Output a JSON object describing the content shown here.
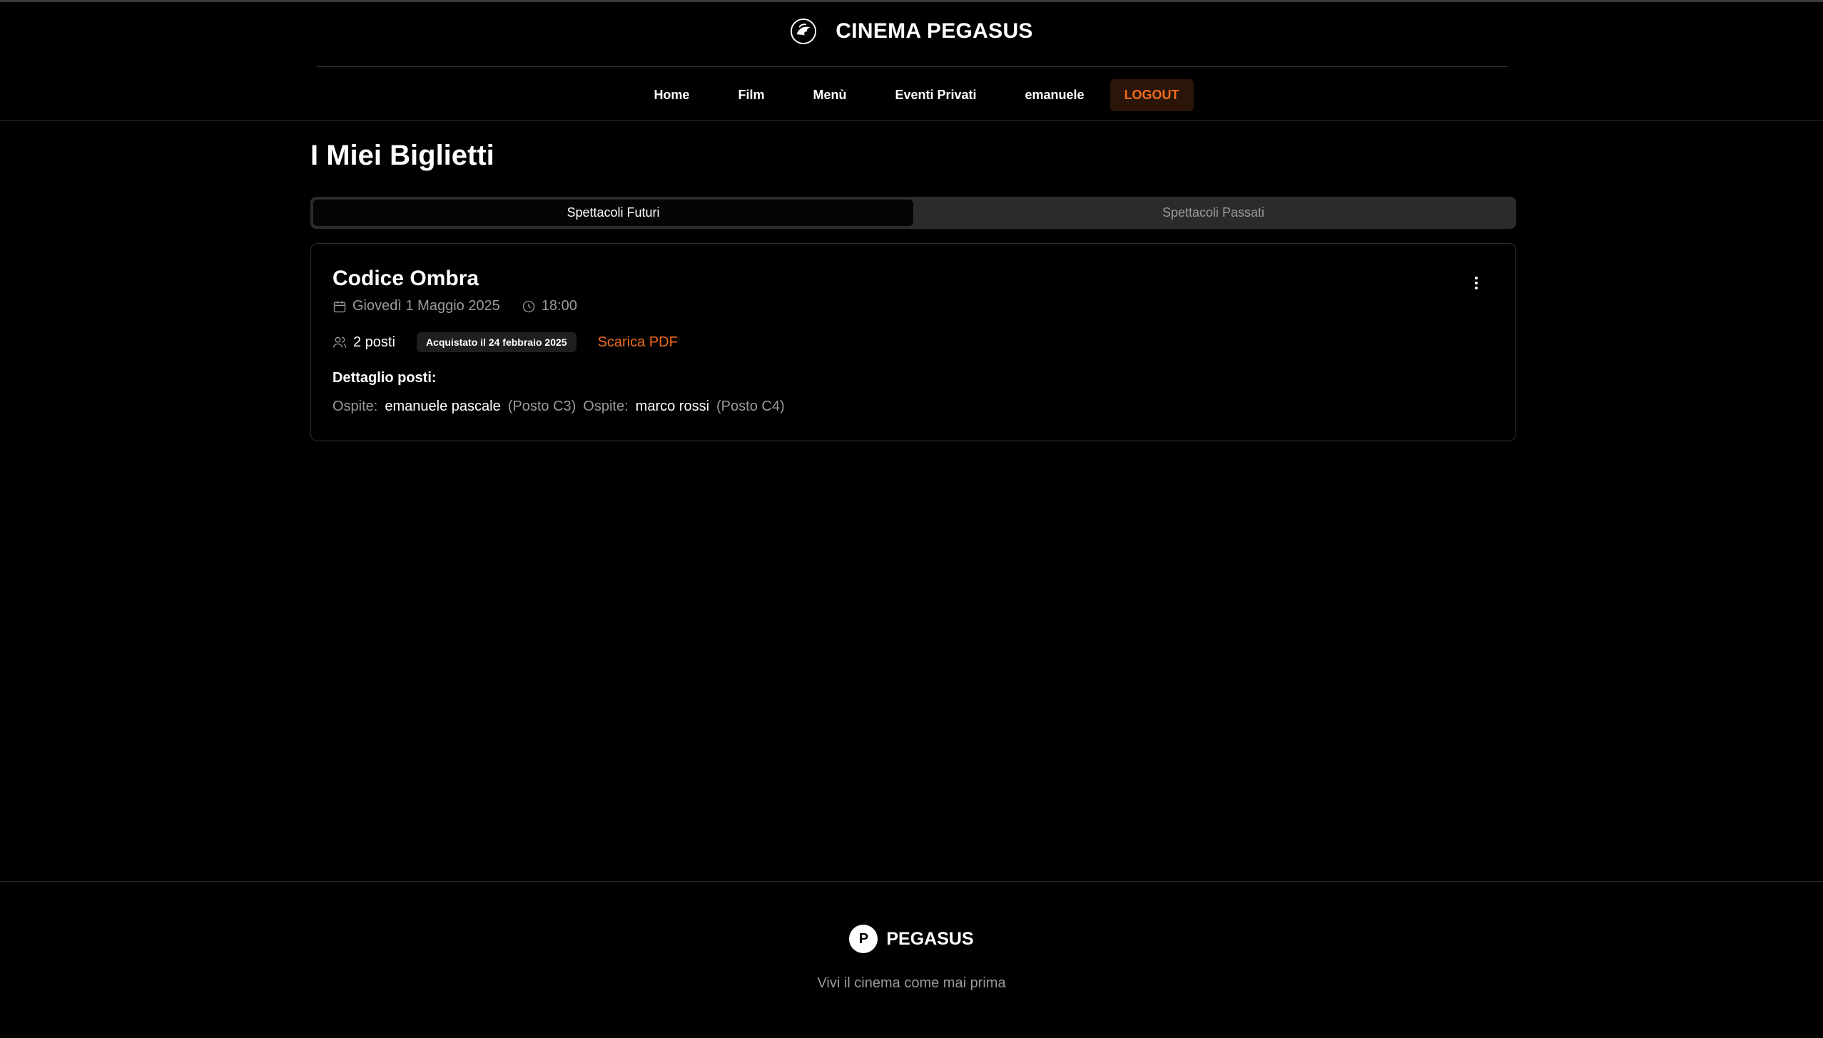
{
  "brand": {
    "title": "CINEMA PEGASUS"
  },
  "nav": {
    "items": [
      {
        "label": "Home"
      },
      {
        "label": "Film"
      },
      {
        "label": "Menù"
      },
      {
        "label": "Eventi Privati"
      },
      {
        "label": "emanuele"
      }
    ],
    "logout_label": "LOGOUT"
  },
  "page": {
    "title": "I Miei Biglietti"
  },
  "tabs": [
    {
      "label": "Spettacoli Futuri",
      "active": true
    },
    {
      "label": "Spettacoli Passati",
      "active": false
    }
  ],
  "ticket": {
    "title": "Codice Ombra",
    "date": "Giovedì 1 Maggio 2025",
    "time": "18:00",
    "seats": "2 posti",
    "purchase_badge": "Acquistato il 24 febbraio 2025",
    "pdf_label": "Scarica PDF",
    "detail_label": "Dettaglio posti:",
    "guests": [
      {
        "label": "Ospite:",
        "name": "emanuele pascale",
        "seat": "(Posto C3)"
      },
      {
        "label": "Ospite:",
        "name": "marco rossi",
        "seat": "(Posto C4)"
      }
    ]
  },
  "footer": {
    "logo_letter": "P",
    "name": "PEGASUS",
    "tagline": "Vivi il cinema come mai prima"
  },
  "colors": {
    "accent": "#f26b1d",
    "background": "#000000",
    "muted": "#9a9a9a"
  },
  "icons": [
    "pegasus-logo-icon",
    "calendar-icon",
    "clock-icon",
    "users-icon",
    "more-vertical-icon"
  ]
}
